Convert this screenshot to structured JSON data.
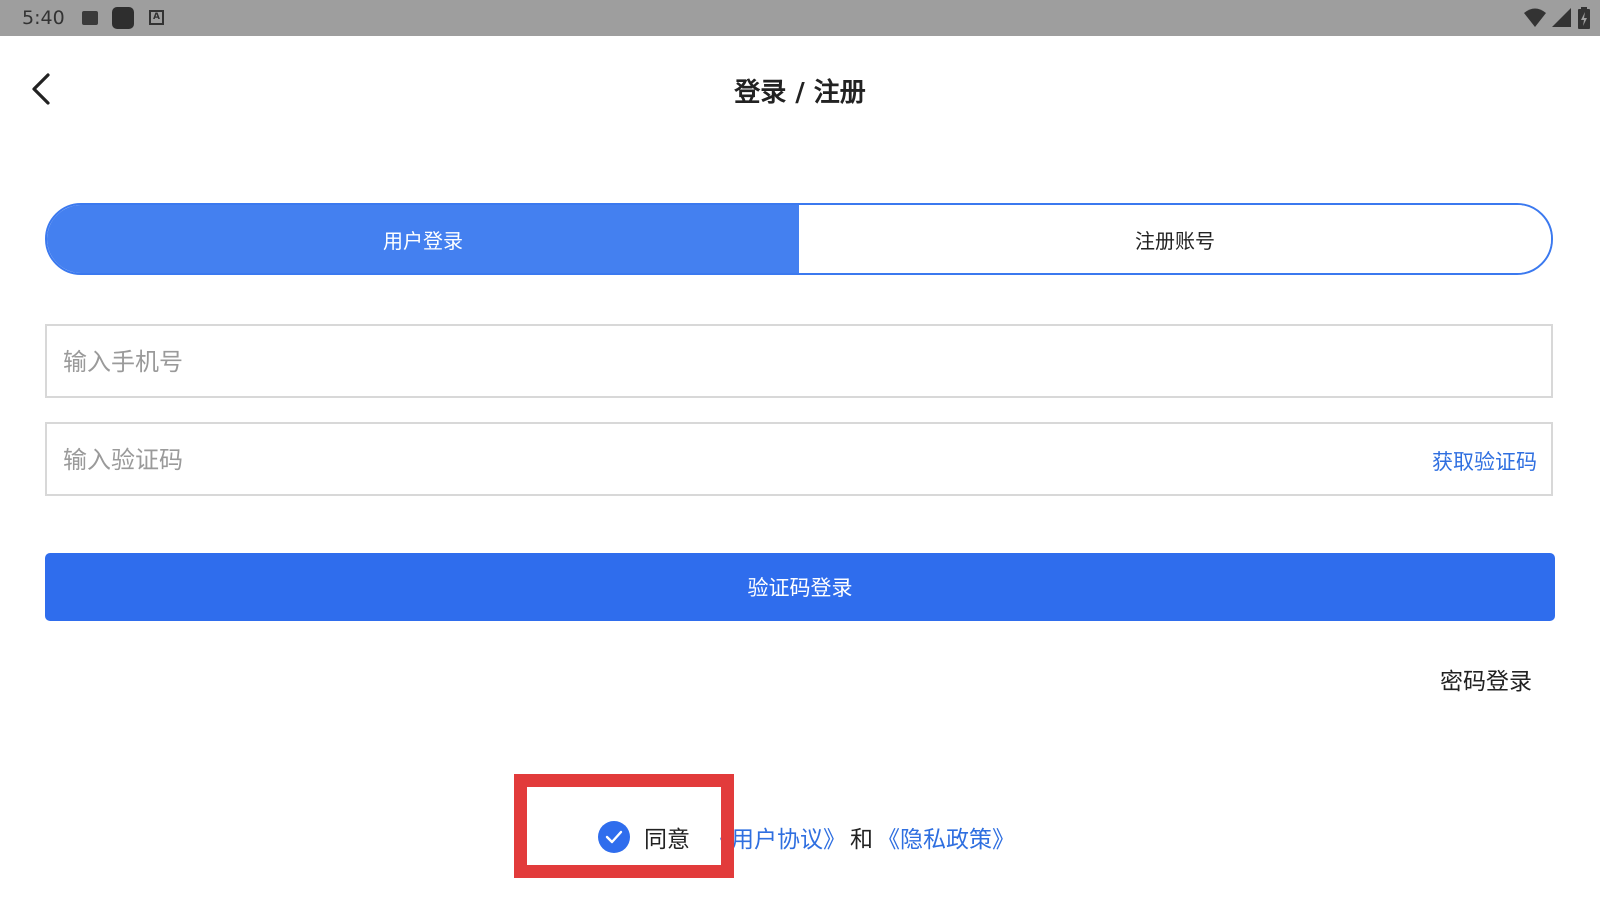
{
  "status_bar": {
    "time": "5:40",
    "icons": [
      "image-icon",
      "app-square-icon",
      "keyboard-a-icon",
      "wifi-icon",
      "signal-icon",
      "battery-icon"
    ]
  },
  "header": {
    "title": "登录 / 注册",
    "back_icon": "chevron-left-icon"
  },
  "tabs": [
    {
      "label": "用户登录",
      "active": true
    },
    {
      "label": "注册账号",
      "active": false
    }
  ],
  "form": {
    "phone_placeholder": "输入手机号",
    "code_placeholder": "输入验证码",
    "get_code_label": "获取验证码",
    "submit_label": "验证码登录",
    "password_login_label": "密码登录"
  },
  "agreement": {
    "checked": true,
    "prefix": "同意",
    "user_agreement": "《用户协议》",
    "and": "和",
    "privacy_policy": "《隐私政策》"
  },
  "colors": {
    "accent": "#2f6ded",
    "tab_active": "#4480f0",
    "link": "#2f6fe0",
    "highlight": "#e23b3b",
    "status_bar": "#9e9e9e"
  }
}
